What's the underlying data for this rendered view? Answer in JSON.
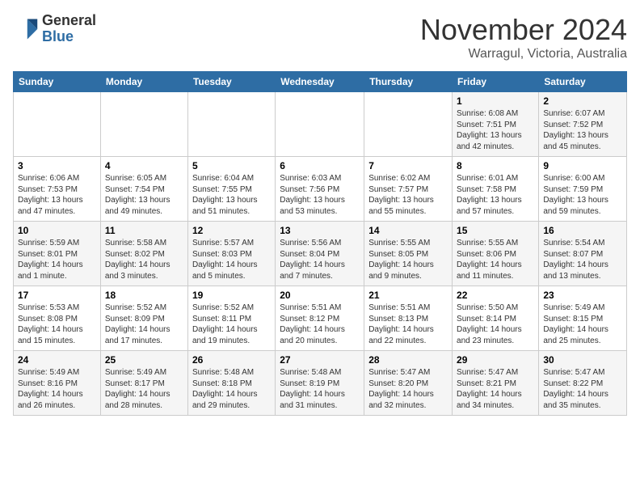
{
  "header": {
    "logo_line1": "General",
    "logo_line2": "Blue",
    "month": "November 2024",
    "location": "Warragul, Victoria, Australia"
  },
  "weekdays": [
    "Sunday",
    "Monday",
    "Tuesday",
    "Wednesday",
    "Thursday",
    "Friday",
    "Saturday"
  ],
  "weeks": [
    [
      {
        "day": "",
        "info": ""
      },
      {
        "day": "",
        "info": ""
      },
      {
        "day": "",
        "info": ""
      },
      {
        "day": "",
        "info": ""
      },
      {
        "day": "",
        "info": ""
      },
      {
        "day": "1",
        "info": "Sunrise: 6:08 AM\nSunset: 7:51 PM\nDaylight: 13 hours\nand 42 minutes."
      },
      {
        "day": "2",
        "info": "Sunrise: 6:07 AM\nSunset: 7:52 PM\nDaylight: 13 hours\nand 45 minutes."
      }
    ],
    [
      {
        "day": "3",
        "info": "Sunrise: 6:06 AM\nSunset: 7:53 PM\nDaylight: 13 hours\nand 47 minutes."
      },
      {
        "day": "4",
        "info": "Sunrise: 6:05 AM\nSunset: 7:54 PM\nDaylight: 13 hours\nand 49 minutes."
      },
      {
        "day": "5",
        "info": "Sunrise: 6:04 AM\nSunset: 7:55 PM\nDaylight: 13 hours\nand 51 minutes."
      },
      {
        "day": "6",
        "info": "Sunrise: 6:03 AM\nSunset: 7:56 PM\nDaylight: 13 hours\nand 53 minutes."
      },
      {
        "day": "7",
        "info": "Sunrise: 6:02 AM\nSunset: 7:57 PM\nDaylight: 13 hours\nand 55 minutes."
      },
      {
        "day": "8",
        "info": "Sunrise: 6:01 AM\nSunset: 7:58 PM\nDaylight: 13 hours\nand 57 minutes."
      },
      {
        "day": "9",
        "info": "Sunrise: 6:00 AM\nSunset: 7:59 PM\nDaylight: 13 hours\nand 59 minutes."
      }
    ],
    [
      {
        "day": "10",
        "info": "Sunrise: 5:59 AM\nSunset: 8:01 PM\nDaylight: 14 hours\nand 1 minute."
      },
      {
        "day": "11",
        "info": "Sunrise: 5:58 AM\nSunset: 8:02 PM\nDaylight: 14 hours\nand 3 minutes."
      },
      {
        "day": "12",
        "info": "Sunrise: 5:57 AM\nSunset: 8:03 PM\nDaylight: 14 hours\nand 5 minutes."
      },
      {
        "day": "13",
        "info": "Sunrise: 5:56 AM\nSunset: 8:04 PM\nDaylight: 14 hours\nand 7 minutes."
      },
      {
        "day": "14",
        "info": "Sunrise: 5:55 AM\nSunset: 8:05 PM\nDaylight: 14 hours\nand 9 minutes."
      },
      {
        "day": "15",
        "info": "Sunrise: 5:55 AM\nSunset: 8:06 PM\nDaylight: 14 hours\nand 11 minutes."
      },
      {
        "day": "16",
        "info": "Sunrise: 5:54 AM\nSunset: 8:07 PM\nDaylight: 14 hours\nand 13 minutes."
      }
    ],
    [
      {
        "day": "17",
        "info": "Sunrise: 5:53 AM\nSunset: 8:08 PM\nDaylight: 14 hours\nand 15 minutes."
      },
      {
        "day": "18",
        "info": "Sunrise: 5:52 AM\nSunset: 8:09 PM\nDaylight: 14 hours\nand 17 minutes."
      },
      {
        "day": "19",
        "info": "Sunrise: 5:52 AM\nSunset: 8:11 PM\nDaylight: 14 hours\nand 19 minutes."
      },
      {
        "day": "20",
        "info": "Sunrise: 5:51 AM\nSunset: 8:12 PM\nDaylight: 14 hours\nand 20 minutes."
      },
      {
        "day": "21",
        "info": "Sunrise: 5:51 AM\nSunset: 8:13 PM\nDaylight: 14 hours\nand 22 minutes."
      },
      {
        "day": "22",
        "info": "Sunrise: 5:50 AM\nSunset: 8:14 PM\nDaylight: 14 hours\nand 23 minutes."
      },
      {
        "day": "23",
        "info": "Sunrise: 5:49 AM\nSunset: 8:15 PM\nDaylight: 14 hours\nand 25 minutes."
      }
    ],
    [
      {
        "day": "24",
        "info": "Sunrise: 5:49 AM\nSunset: 8:16 PM\nDaylight: 14 hours\nand 26 minutes."
      },
      {
        "day": "25",
        "info": "Sunrise: 5:49 AM\nSunset: 8:17 PM\nDaylight: 14 hours\nand 28 minutes."
      },
      {
        "day": "26",
        "info": "Sunrise: 5:48 AM\nSunset: 8:18 PM\nDaylight: 14 hours\nand 29 minutes."
      },
      {
        "day": "27",
        "info": "Sunrise: 5:48 AM\nSunset: 8:19 PM\nDaylight: 14 hours\nand 31 minutes."
      },
      {
        "day": "28",
        "info": "Sunrise: 5:47 AM\nSunset: 8:20 PM\nDaylight: 14 hours\nand 32 minutes."
      },
      {
        "day": "29",
        "info": "Sunrise: 5:47 AM\nSunset: 8:21 PM\nDaylight: 14 hours\nand 34 minutes."
      },
      {
        "day": "30",
        "info": "Sunrise: 5:47 AM\nSunset: 8:22 PM\nDaylight: 14 hours\nand 35 minutes."
      }
    ]
  ]
}
